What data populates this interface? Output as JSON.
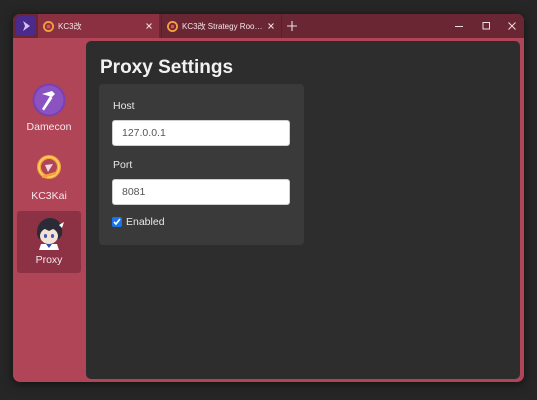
{
  "tabs": [
    {
      "title": "KC3改"
    },
    {
      "title": "KC3改 Strategy Room -..."
    }
  ],
  "sidebar": {
    "items": [
      {
        "label": "Damecon"
      },
      {
        "label": "KC3Kai"
      },
      {
        "label": "Proxy",
        "active": true
      }
    ]
  },
  "proxy": {
    "title": "Proxy Settings",
    "host_label": "Host",
    "host_value": "127.0.0.1",
    "port_label": "Port",
    "port_value": "8081",
    "enabled_label": "Enabled",
    "enabled": true
  },
  "colors": {
    "window_frame": "#b04558",
    "titlebar": "#6b2634",
    "active_tab": "#8a3040",
    "sidebar_active": "#8d3244",
    "content_bg": "#2d2d2d",
    "card_bg": "#3a3a3a"
  },
  "icons": {
    "app": "app-logo-icon",
    "tab": "kc3-favicon-icon",
    "damecon": "repair-hammer-icon",
    "kc3kai": "kc3kai-logo-icon",
    "proxy": "character-avatar-icon"
  }
}
